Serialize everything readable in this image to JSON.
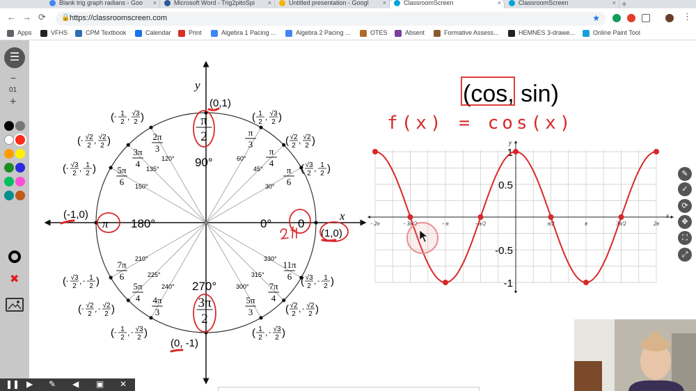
{
  "browser": {
    "tabs": [
      {
        "title": "Blank trig graph radians - Goo",
        "color": "#4285f4",
        "active": false
      },
      {
        "title": "Microsoft Word - Trig2pitoSpi",
        "color": "#2b579a",
        "active": false
      },
      {
        "title": "Untitled presentation - Googl",
        "color": "#f4b400",
        "active": false
      },
      {
        "title": "ClassroomScreen",
        "color": "#00a3d9",
        "active": true
      },
      {
        "title": "ClassroomScreen",
        "color": "#00a3d9",
        "active": false
      }
    ],
    "new_tab": "+",
    "url": "https://classroomscreen.com",
    "bookmarks": [
      {
        "label": "Apps",
        "color": "#5f6368"
      },
      {
        "label": "VFHS",
        "color": "#222222"
      },
      {
        "label": "CPM Textbook",
        "color": "#2d6db5"
      },
      {
        "label": "Calendar",
        "color": "#1a73e8"
      },
      {
        "label": "Print",
        "color": "#d93025"
      },
      {
        "label": "Algebra 1 Pacing ...",
        "color": "#4285f4"
      },
      {
        "label": "Algebra 2 Pacing ...",
        "color": "#4285f4"
      },
      {
        "label": "OTES",
        "color": "#b06a2a"
      },
      {
        "label": "Absent",
        "color": "#7b3fa0"
      },
      {
        "label": "Formative Assess...",
        "color": "#8a5a2b"
      },
      {
        "label": "HEMNES 3-drawe...",
        "color": "#222222"
      },
      {
        "label": "Online Paint Tool",
        "color": "#1aa0d8"
      }
    ]
  },
  "sidebar": {
    "menu": "☰",
    "minus": "−",
    "number": "01",
    "plus": "+",
    "colors": [
      "#000000",
      "#777777",
      "#ffffff",
      "#ff2a1a",
      "#ff9d00",
      "#fff200",
      "#1f8c1f",
      "#2a2ae0",
      "#00c060",
      "#ff4fd8",
      "#009090",
      "#c05a1a"
    ]
  },
  "unit_circle": {
    "axis_x": "x",
    "axis_y": "y",
    "angle_labels": [
      {
        "text": "90°"
      },
      {
        "text": "180°"
      },
      {
        "text": "0°"
      },
      {
        "text": "270°"
      },
      {
        "text": "60°"
      },
      {
        "text": "45°"
      },
      {
        "text": "30°"
      },
      {
        "text": "120°"
      },
      {
        "text": "135°"
      },
      {
        "text": "150°"
      },
      {
        "text": "210°"
      },
      {
        "text": "225°"
      },
      {
        "text": "240°"
      },
      {
        "text": "300°"
      },
      {
        "text": "315°"
      },
      {
        "text": "330°"
      }
    ],
    "points": [
      {
        "text": "(0,1)"
      },
      {
        "text": "(-1,0)"
      },
      {
        "text": "(1,0)"
      },
      {
        "text": "(0, -1)"
      }
    ],
    "radians": [
      {
        "num": "π",
        "den": "2"
      },
      {
        "num": "π",
        "den": "3"
      },
      {
        "num": "π",
        "den": "4"
      },
      {
        "num": "π",
        "den": "6"
      },
      {
        "num": "2π",
        "den": "3"
      },
      {
        "num": "3π",
        "den": "4"
      },
      {
        "num": "5π",
        "den": "6"
      },
      {
        "num": "7π",
        "den": "6"
      },
      {
        "num": "5π",
        "den": "4"
      },
      {
        "num": "4π",
        "den": "3"
      },
      {
        "num": "3π",
        "den": "2"
      },
      {
        "num": "5π",
        "den": "3"
      },
      {
        "num": "7π",
        "den": "4"
      },
      {
        "num": "11π",
        "den": "6"
      }
    ],
    "pi_label": "π",
    "zero_label": "0",
    "coord_pairs": [
      {
        "x": "1",
        "xd": "2",
        "y": "√3",
        "yd": "2",
        "xs": "-",
        "ys": ""
      },
      {
        "x": "1",
        "xd": "2",
        "y": "√3",
        "yd": "2",
        "xs": "",
        "ys": ""
      },
      {
        "x": "√2",
        "xd": "2",
        "y": "√2",
        "yd": "2",
        "xs": "-",
        "ys": ""
      },
      {
        "x": "√2",
        "xd": "2",
        "y": "√2",
        "yd": "2",
        "xs": "",
        "ys": ""
      },
      {
        "x": "√3",
        "xd": "2",
        "y": "1",
        "yd": "2",
        "xs": "-",
        "ys": ""
      },
      {
        "x": "√3",
        "xd": "2",
        "y": "1",
        "yd": "2",
        "xs": "",
        "ys": ""
      },
      {
        "x": "√3",
        "xd": "2",
        "y": "1",
        "yd": "2",
        "xs": "-",
        "ys": "-"
      },
      {
        "x": "√3",
        "xd": "2",
        "y": "1",
        "yd": "2",
        "xs": "",
        "ys": "-"
      },
      {
        "x": "√2",
        "xd": "2",
        "y": "√2",
        "yd": "2",
        "xs": "-",
        "ys": "-"
      },
      {
        "x": "√2",
        "xd": "2",
        "y": "√2",
        "yd": "2",
        "xs": "",
        "ys": "-"
      },
      {
        "x": "1",
        "xd": "2",
        "y": "√3",
        "yd": "2",
        "xs": "-",
        "ys": "-"
      },
      {
        "x": "1",
        "xd": "2",
        "y": "√3",
        "yd": "2",
        "xs": "",
        "ys": "-"
      }
    ]
  },
  "graph": {
    "title": "(cos, sin)",
    "function_label": "f(x) = cos(x)",
    "axis_x": "x",
    "axis_y": "y",
    "y_ticks": [
      "1",
      "0.5",
      "-0.5",
      "-1"
    ],
    "x_ticks": [
      "- 2π",
      "- 3π/2",
      "- π",
      "- π/2",
      "0",
      "π/2",
      "π",
      "3π/2",
      "2π"
    ],
    "ink_color": "#d8282a"
  },
  "chart_data": {
    "type": "line",
    "title": "(cos, sin)",
    "xlabel": "x",
    "ylabel": "y",
    "series": [
      {
        "name": "",
        "x": [
          "-2π",
          "-3π/2",
          "-π",
          "-π/2",
          "0",
          "π/2",
          "π",
          "3π/2",
          "2π"
        ],
        "values": [
          1,
          0,
          -1,
          0,
          1,
          0,
          -1,
          0,
          1
        ]
      }
    ],
    "ylim": [
      -1,
      1
    ],
    "grid": true
  },
  "right_tools": [
    "✎",
    "✓",
    "⟳",
    "✥",
    "⛶",
    "⤢"
  ],
  "bottom_bar": [
    "❚❚",
    "▶",
    "✎",
    "◀",
    "▣",
    "✕"
  ]
}
